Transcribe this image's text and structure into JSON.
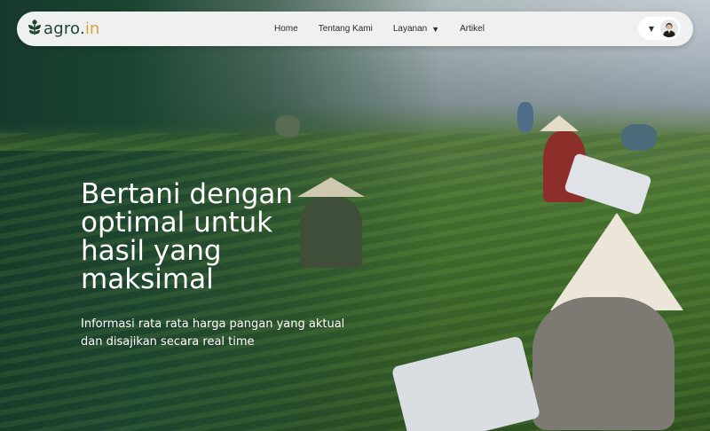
{
  "navbar": {
    "brand_name": "agro.",
    "brand_tld": "in",
    "items": [
      {
        "label": "Home"
      },
      {
        "label": "Tentang Kami"
      },
      {
        "label": "Layanan"
      },
      {
        "label": "Artikel"
      }
    ]
  },
  "hero": {
    "title": "Bertani dengan optimal untuk hasil yang maksimal",
    "subtitle": "Informasi rata rata harga pangan yang aktual dan disajikan secara real time"
  },
  "colors": {
    "brand_dark": "#1f3f2f",
    "brand_accent": "#d9a43a",
    "navbar_bg": "#eef1ef",
    "overlay_green": "#173a2c"
  },
  "icons": {
    "logo": "leaf-logo-icon",
    "dropdown": "caret-down-icon",
    "user": "avatar"
  }
}
